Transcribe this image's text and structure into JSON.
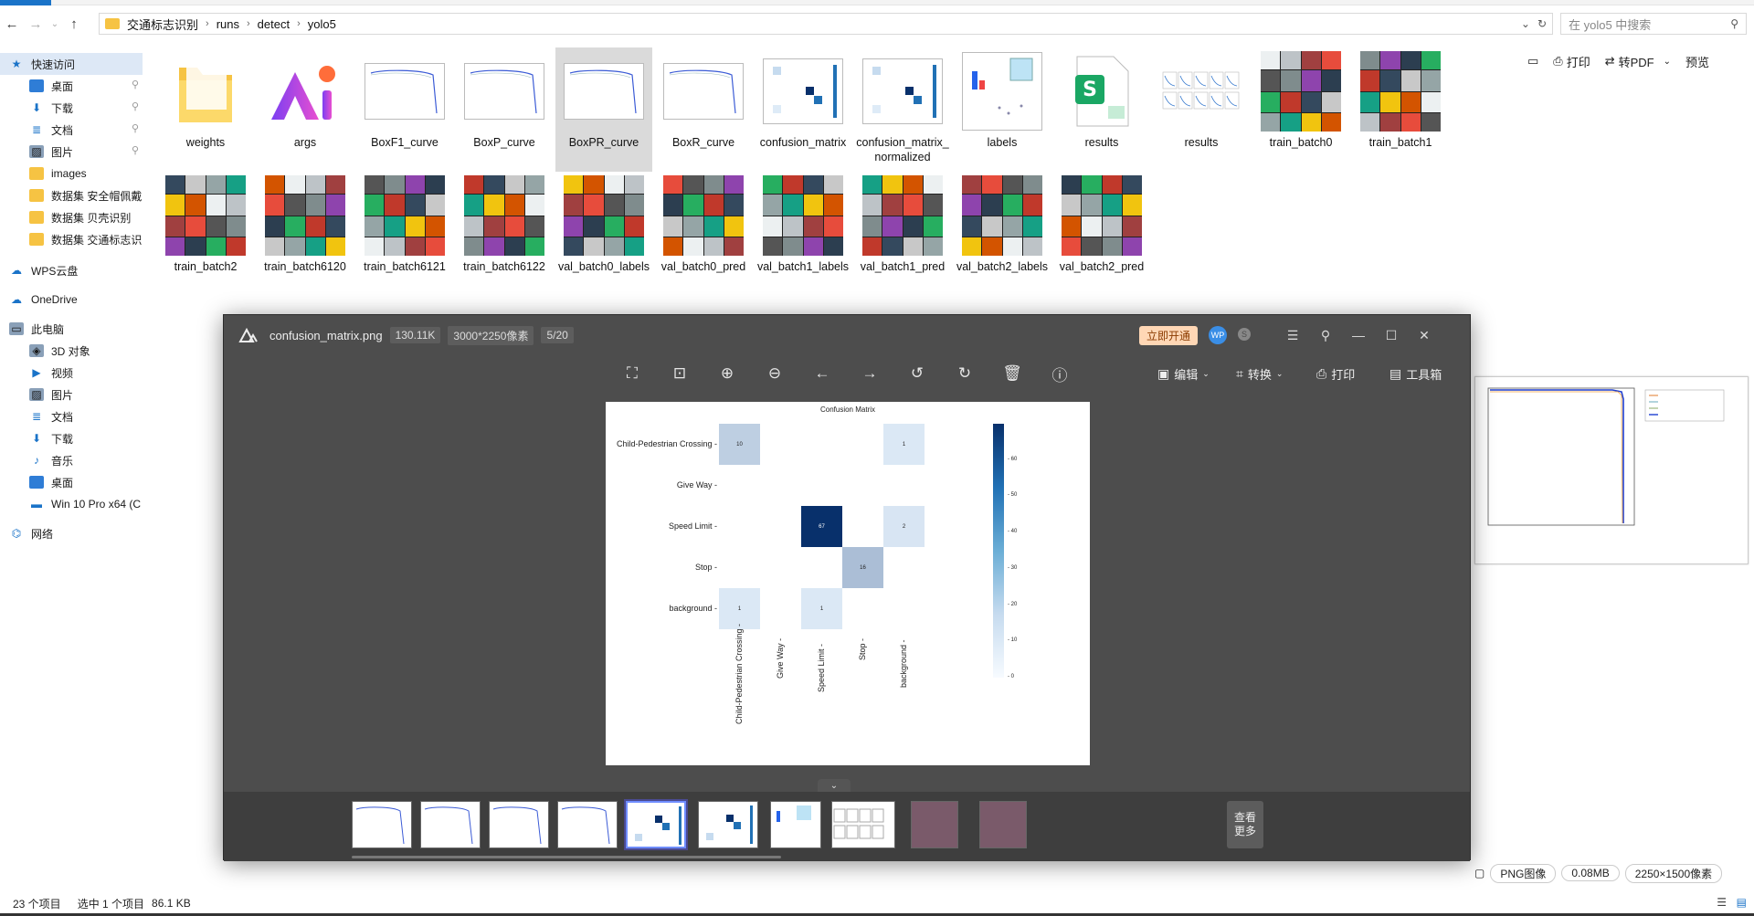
{
  "explorer": {
    "breadcrumb": [
      "交通标志识别",
      "runs",
      "detect",
      "yolo5"
    ],
    "search_placeholder": "在 yolo5 中搜索",
    "sidebar": [
      {
        "label": "快速访问",
        "kind": "quick"
      },
      {
        "label": "桌面",
        "kind": "desktop",
        "pinned": true
      },
      {
        "label": "下载",
        "kind": "download",
        "pinned": true
      },
      {
        "label": "文档",
        "kind": "document",
        "pinned": true
      },
      {
        "label": "图片",
        "kind": "picture",
        "pinned": true
      },
      {
        "label": "images",
        "kind": "folder"
      },
      {
        "label": "数据集 安全帽佩戴",
        "kind": "folder"
      },
      {
        "label": "数据集 贝壳识别",
        "kind": "folder"
      },
      {
        "label": "数据集 交通标志识别",
        "kind": "folder"
      },
      {
        "label": "WPS云盘",
        "kind": "cloud"
      },
      {
        "label": "OneDrive",
        "kind": "onedrive"
      },
      {
        "label": "此电脑",
        "kind": "pc"
      },
      {
        "label": "3D 对象",
        "kind": "3d"
      },
      {
        "label": "视频",
        "kind": "video"
      },
      {
        "label": "图片",
        "kind": "picture"
      },
      {
        "label": "文档",
        "kind": "document"
      },
      {
        "label": "下载",
        "kind": "download"
      },
      {
        "label": "音乐",
        "kind": "music"
      },
      {
        "label": "桌面",
        "kind": "desktop"
      },
      {
        "label": "Win 10 Pro x64 (C",
        "kind": "drive"
      },
      {
        "label": "网络",
        "kind": "network"
      }
    ],
    "files": [
      {
        "name": "weights",
        "kind": "folder"
      },
      {
        "name": "args",
        "kind": "app"
      },
      {
        "name": "BoxF1_curve",
        "kind": "curve"
      },
      {
        "name": "BoxP_curve",
        "kind": "curve"
      },
      {
        "name": "BoxPR_curve",
        "kind": "curve",
        "selected": true
      },
      {
        "name": "BoxR_curve",
        "kind": "curve"
      },
      {
        "name": "confusion_matrix",
        "kind": "matrix"
      },
      {
        "name": "confusion_matrix_normalized",
        "kind": "matrix"
      },
      {
        "name": "labels",
        "kind": "labels"
      },
      {
        "name": "results",
        "kind": "sheet"
      },
      {
        "name": "results",
        "kind": "plots"
      },
      {
        "name": "train_batch0",
        "kind": "mosaic"
      },
      {
        "name": "train_batch1",
        "kind": "mosaic"
      },
      {
        "name": "train_batch2",
        "kind": "mosaic"
      },
      {
        "name": "train_batch6120",
        "kind": "mosaic"
      },
      {
        "name": "train_batch6121",
        "kind": "mosaic"
      },
      {
        "name": "train_batch6122",
        "kind": "mosaic"
      },
      {
        "name": "val_batch0_labels",
        "kind": "mosaic"
      },
      {
        "name": "val_batch0_pred",
        "kind": "mosaic"
      },
      {
        "name": "val_batch1_labels",
        "kind": "mosaic"
      },
      {
        "name": "val_batch1_pred",
        "kind": "mosaic"
      },
      {
        "name": "val_batch2_labels",
        "kind": "mosaic"
      },
      {
        "name": "val_batch2_pred",
        "kind": "mosaic"
      }
    ],
    "right_toolbar": {
      "print": "打印",
      "to_pdf": "转PDF",
      "preview": "预览"
    },
    "preview_bottom": {
      "type": "PNG图像",
      "size": "0.08MB",
      "dims": "2250×1500像素"
    },
    "status": {
      "count": "23 个项目",
      "selection": "选中 1 个项目",
      "sel_size": "86.1 KB"
    }
  },
  "viewer": {
    "file_name": "confusion_matrix.png",
    "file_size": "130.11K",
    "dimensions": "3000*2250像素",
    "position": "5/20",
    "promo": "立即开通",
    "avatar": "WP",
    "tools_right": {
      "edit": "编辑",
      "convert": "转换",
      "print": "打印",
      "toolbox": "工具箱"
    },
    "more_label": "查看更多",
    "film_active_index": 4
  },
  "matrix": {
    "title": "Confusion Matrix",
    "labels": [
      "Child-Pedestrian Crossing",
      "Give Way",
      "Speed Limit",
      "Stop",
      "background"
    ],
    "values": [
      [
        10,
        0,
        0,
        0,
        1
      ],
      [
        0,
        0,
        0,
        0,
        0
      ],
      [
        0,
        0,
        67,
        0,
        2
      ],
      [
        0,
        0,
        0,
        16,
        0
      ],
      [
        1,
        0,
        1,
        0,
        0
      ]
    ],
    "colorbar_ticks": [
      60,
      50,
      40,
      30,
      20,
      10,
      0
    ],
    "max": 67
  }
}
